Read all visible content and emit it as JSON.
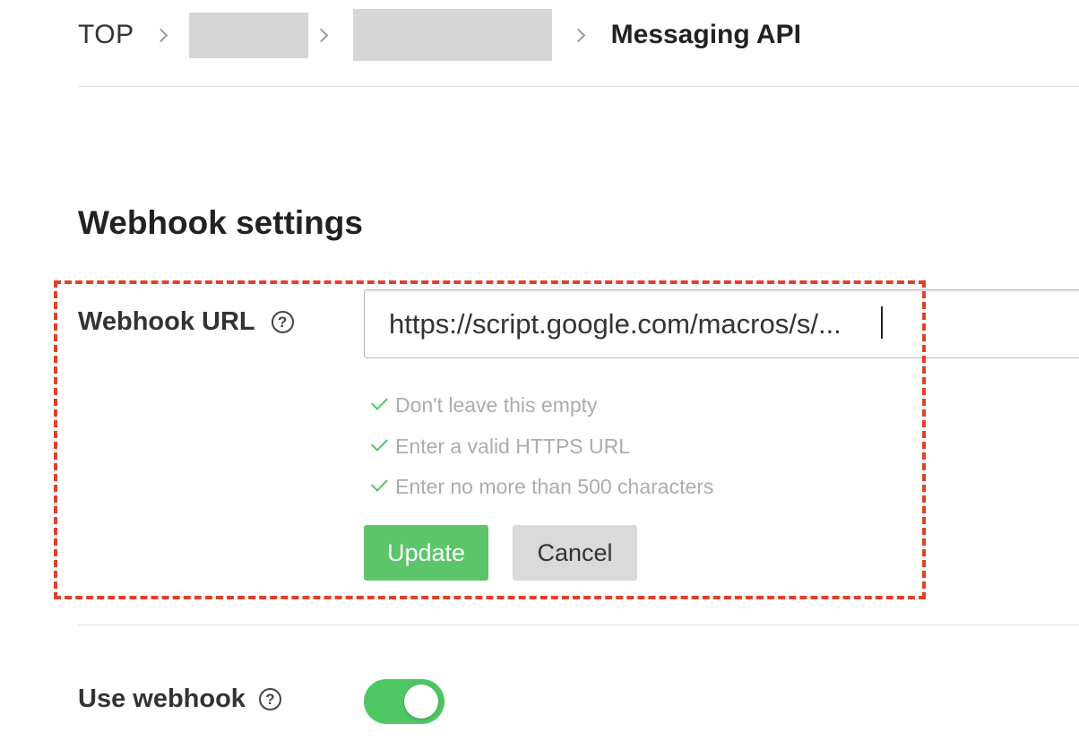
{
  "breadcrumb": {
    "top_label": "TOP",
    "current_label": "Messaging API"
  },
  "webhook_settings": {
    "title": "Webhook settings",
    "url_label": "Webhook URL",
    "url_value": "https://script.google.com/macros/s/...",
    "help_glyph": "?",
    "validations": [
      "Don't leave this empty",
      "Enter a valid HTTPS URL",
      "Enter no more than 500 characters"
    ],
    "update_label": "Update",
    "cancel_label": "Cancel"
  },
  "use_webhook": {
    "label": "Use webhook",
    "enabled": true
  },
  "colors": {
    "accent_green": "#4cc764",
    "button_green": "#5cc56a",
    "highlight_red": "#e0402a",
    "hint_gray": "#a8adb3"
  },
  "icons": {
    "help": "question-circle-icon",
    "check": "check-icon",
    "breadcrumb_separator": "chevron-right-icon"
  }
}
